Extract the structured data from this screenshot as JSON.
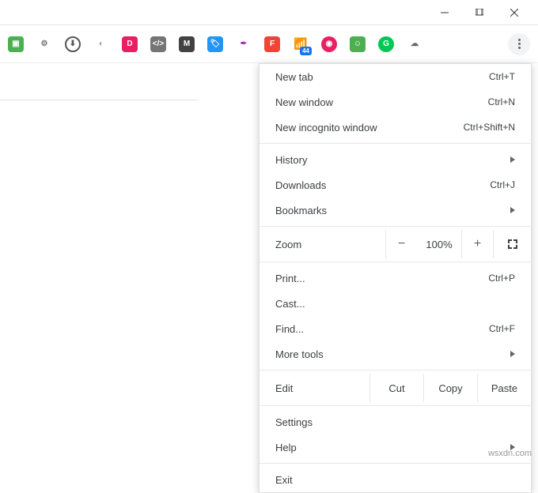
{
  "toolbar": {
    "badge_count": "44"
  },
  "menu": {
    "new_tab": {
      "label": "New tab",
      "shortcut": "Ctrl+T"
    },
    "new_window": {
      "label": "New window",
      "shortcut": "Ctrl+N"
    },
    "new_incognito": {
      "label": "New incognito window",
      "shortcut": "Ctrl+Shift+N"
    },
    "history": {
      "label": "History"
    },
    "downloads": {
      "label": "Downloads",
      "shortcut": "Ctrl+J"
    },
    "bookmarks": {
      "label": "Bookmarks"
    },
    "zoom": {
      "label": "Zoom",
      "minus": "−",
      "value": "100%",
      "plus": "+"
    },
    "print": {
      "label": "Print...",
      "shortcut": "Ctrl+P"
    },
    "cast": {
      "label": "Cast..."
    },
    "find": {
      "label": "Find...",
      "shortcut": "Ctrl+F"
    },
    "more_tools": {
      "label": "More tools"
    },
    "edit": {
      "label": "Edit",
      "cut": "Cut",
      "copy": "Copy",
      "paste": "Paste"
    },
    "settings": {
      "label": "Settings"
    },
    "help": {
      "label": "Help"
    },
    "exit": {
      "label": "Exit"
    }
  },
  "watermark": "wsxdn.com"
}
